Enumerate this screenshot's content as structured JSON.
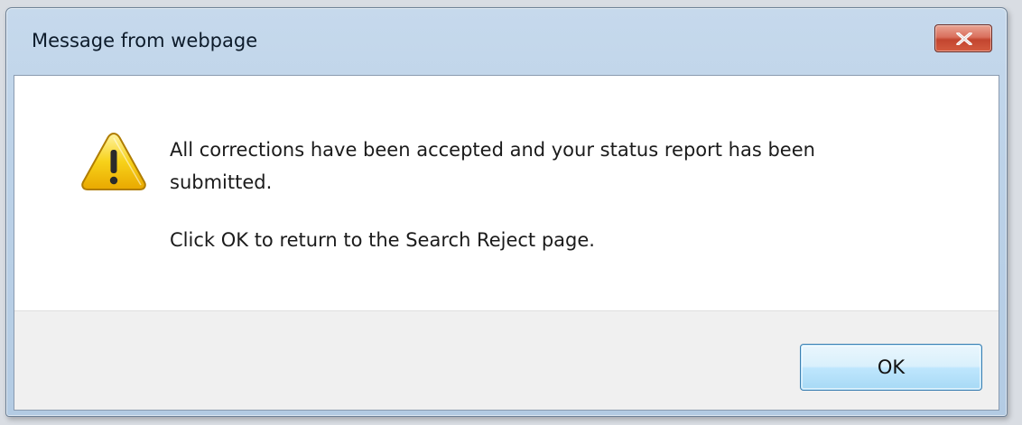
{
  "dialog": {
    "title": "Message from webpage",
    "message_line1": "All corrections have been accepted and your status report has been",
    "message_line1b": "submitted.",
    "message_line2": "Click OK to return to the Search Reject page.",
    "ok_label": "OK",
    "icon": "warning-icon",
    "close_icon": "close-icon"
  },
  "colors": {
    "titlebar": "#bcd2e8",
    "close_button": "#c2452f",
    "button_area": "#f0f0f0",
    "ok_button_border": "#3c7fb1",
    "warning_yellow": "#f5c400"
  }
}
